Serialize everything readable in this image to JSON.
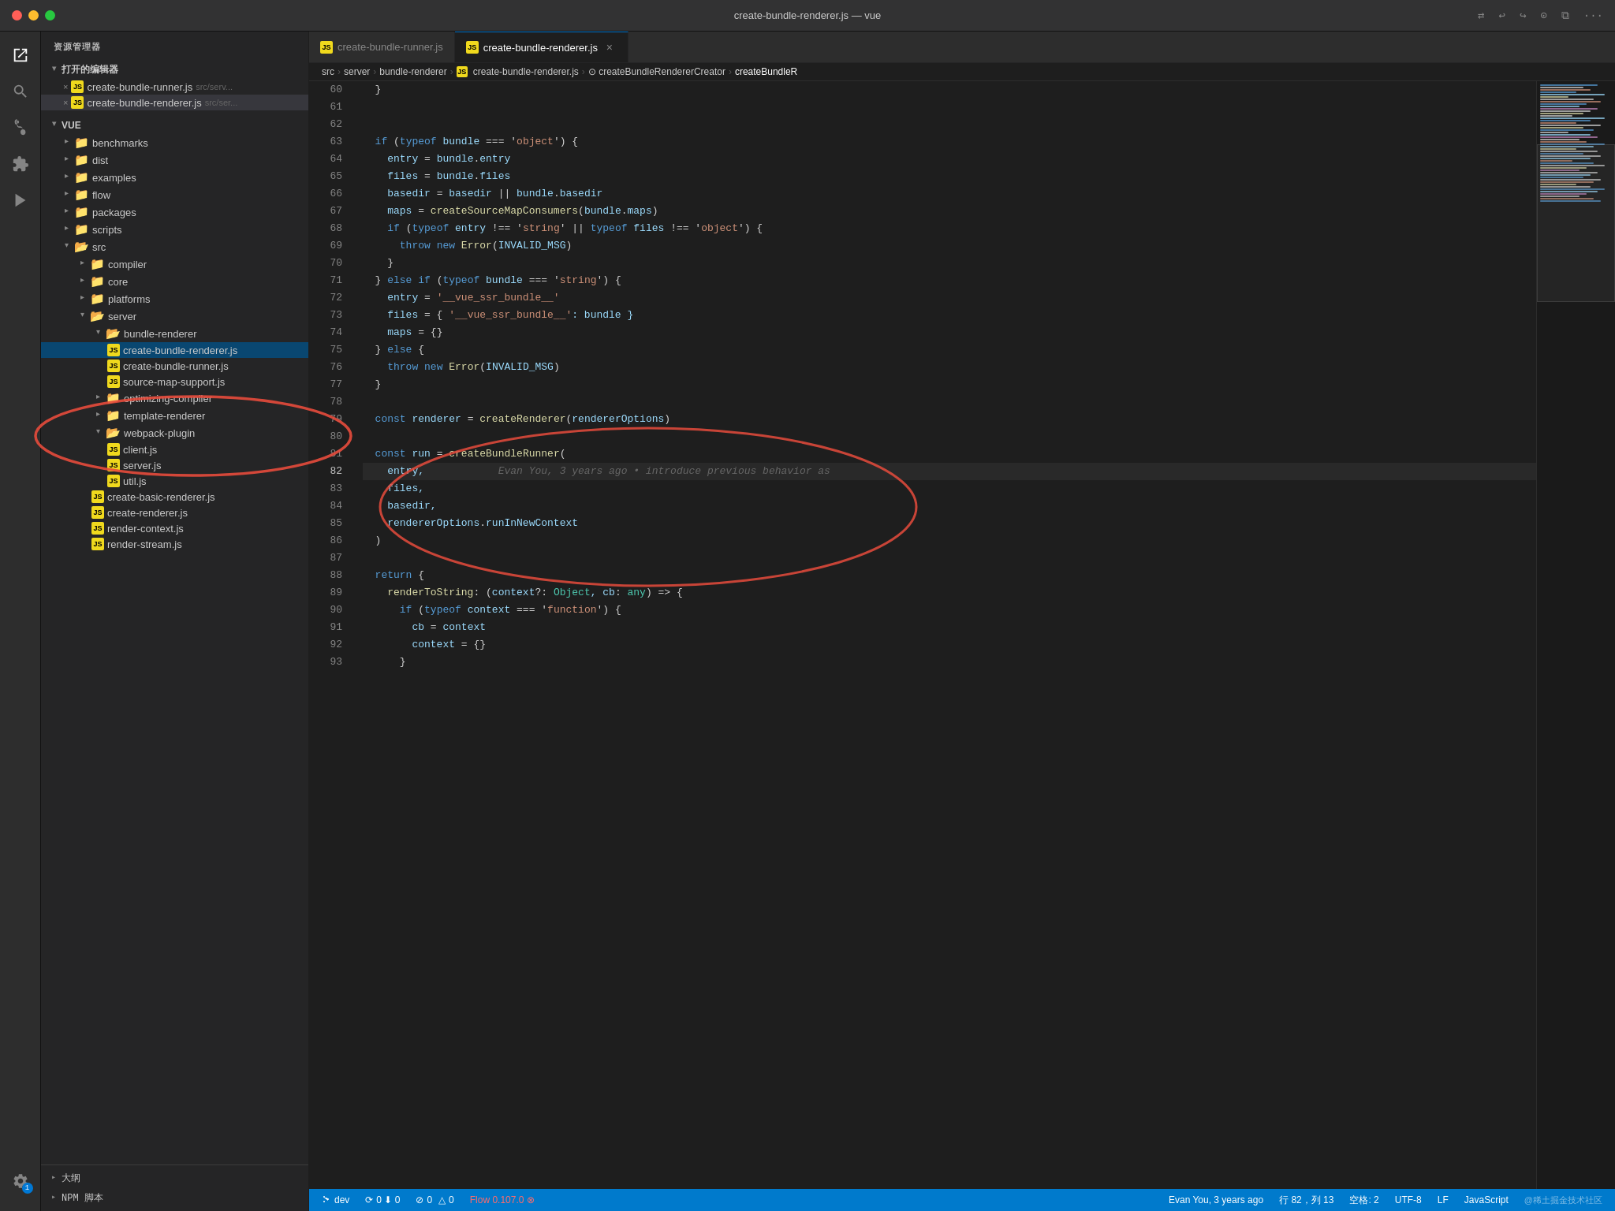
{
  "titlebar": {
    "title": "create-bundle-renderer.js — vue",
    "icons": [
      "sync",
      "back",
      "forward",
      "settings",
      "split",
      "more"
    ]
  },
  "tabs": [
    {
      "id": "tab1",
      "icon": "js",
      "label": "create-bundle-runner.js",
      "active": false,
      "dirty": false,
      "closeable": false
    },
    {
      "id": "tab2",
      "icon": "js",
      "label": "create-bundle-renderer.js",
      "active": true,
      "dirty": false,
      "closeable": true
    }
  ],
  "breadcrumb": {
    "items": [
      "src",
      "server",
      "bundle-renderer",
      "create-bundle-renderer.js",
      "createBundleRendererCreator",
      "createBundleR"
    ]
  },
  "sidebar": {
    "header": "资源管理器",
    "open_editors_label": "打开的编辑器",
    "open_files": [
      {
        "label": "create-bundle-runner.js",
        "path": "src/serv...",
        "dirty": false
      },
      {
        "label": "create-bundle-renderer.js",
        "path": "src/ser...",
        "dirty": true
      }
    ],
    "vue_label": "VUE",
    "tree": [
      {
        "id": "benchmarks",
        "label": "benchmarks",
        "type": "folder",
        "color": "blue",
        "indent": 1
      },
      {
        "id": "dist",
        "label": "dist",
        "type": "folder",
        "color": "yellow",
        "indent": 1
      },
      {
        "id": "examples",
        "label": "examples",
        "type": "folder",
        "color": "blue",
        "indent": 1
      },
      {
        "id": "flow",
        "label": "flow",
        "type": "folder",
        "color": "default",
        "indent": 1
      },
      {
        "id": "packages",
        "label": "packages",
        "type": "folder",
        "color": "blue",
        "indent": 1
      },
      {
        "id": "scripts",
        "label": "scripts",
        "type": "folder",
        "color": "default",
        "indent": 1
      },
      {
        "id": "src",
        "label": "src",
        "type": "folder",
        "color": "yellow",
        "open": true,
        "indent": 1
      },
      {
        "id": "compiler",
        "label": "compiler",
        "type": "folder",
        "color": "default",
        "indent": 2
      },
      {
        "id": "core",
        "label": "core",
        "type": "folder",
        "color": "blue",
        "indent": 2
      },
      {
        "id": "platforms",
        "label": "platforms",
        "type": "folder",
        "color": "default",
        "indent": 2
      },
      {
        "id": "server",
        "label": "server",
        "type": "folder",
        "color": "default",
        "open": true,
        "indent": 2
      },
      {
        "id": "bundle-renderer",
        "label": "bundle-renderer",
        "type": "folder",
        "color": "default",
        "open": true,
        "indent": 3
      },
      {
        "id": "create-bundle-renderer",
        "label": "create-bundle-renderer.js",
        "type": "file-js",
        "indent": 4,
        "active": true
      },
      {
        "id": "create-bundle-runner",
        "label": "create-bundle-runner.js",
        "type": "file-js",
        "indent": 4
      },
      {
        "id": "source-map-support",
        "label": "source-map-support.js",
        "type": "file-js",
        "indent": 4
      },
      {
        "id": "optimizing-compiler",
        "label": "optimizing-compiler",
        "type": "folder",
        "color": "default",
        "indent": 3
      },
      {
        "id": "template-renderer",
        "label": "template-renderer",
        "type": "folder",
        "color": "default",
        "indent": 3
      },
      {
        "id": "webpack-plugin",
        "label": "webpack-plugin",
        "type": "folder",
        "color": "default",
        "open": true,
        "indent": 3
      },
      {
        "id": "client-js",
        "label": "client.js",
        "type": "file-js",
        "indent": 4
      },
      {
        "id": "server-js",
        "label": "server.js",
        "type": "file-js",
        "indent": 4
      },
      {
        "id": "util-js",
        "label": "util.js",
        "type": "file-js",
        "indent": 4
      },
      {
        "id": "create-basic-renderer",
        "label": "create-basic-renderer.js",
        "type": "file-js",
        "indent": 3
      },
      {
        "id": "create-renderer",
        "label": "create-renderer.js",
        "type": "file-js",
        "indent": 3
      },
      {
        "id": "render-context",
        "label": "render-context.js",
        "type": "file-js",
        "indent": 3
      },
      {
        "id": "render-stream",
        "label": "render-stream.js",
        "type": "file-js",
        "indent": 3
      }
    ],
    "outline_label": "大纲",
    "npm_label": "NPM 脚本"
  },
  "code": {
    "lines": [
      {
        "num": 60,
        "tokens": [
          {
            "t": "  ",
            "c": ""
          },
          {
            "t": "}",
            "c": "punc"
          }
        ]
      },
      {
        "num": 61,
        "tokens": []
      },
      {
        "num": 62,
        "tokens": []
      },
      {
        "num": 63,
        "tokens": [
          {
            "t": "  ",
            "c": ""
          },
          {
            "t": "if",
            "c": "kw"
          },
          {
            "t": " (",
            "c": "punc"
          },
          {
            "t": "typeof",
            "c": "kw"
          },
          {
            "t": " bundle ",
            "c": "var"
          },
          {
            "t": "===",
            "c": "op"
          },
          {
            "t": " '",
            "c": "op"
          },
          {
            "t": "object",
            "c": "str"
          },
          {
            "t": "') {",
            "c": "punc"
          }
        ]
      },
      {
        "num": 64,
        "tokens": [
          {
            "t": "    entry",
            "c": "var"
          },
          {
            "t": " = ",
            "c": "op"
          },
          {
            "t": "bundle",
            "c": "var"
          },
          {
            "t": ".",
            "c": "punc"
          },
          {
            "t": "entry",
            "c": "prop"
          }
        ]
      },
      {
        "num": 65,
        "tokens": [
          {
            "t": "    files",
            "c": "var"
          },
          {
            "t": " = ",
            "c": "op"
          },
          {
            "t": "bundle",
            "c": "var"
          },
          {
            "t": ".",
            "c": "punc"
          },
          {
            "t": "files",
            "c": "prop"
          }
        ]
      },
      {
        "num": 66,
        "tokens": [
          {
            "t": "    basedir",
            "c": "var"
          },
          {
            "t": " = ",
            "c": "op"
          },
          {
            "t": "basedir",
            "c": "var"
          },
          {
            "t": " || ",
            "c": "op"
          },
          {
            "t": "bundle",
            "c": "var"
          },
          {
            "t": ".",
            "c": "punc"
          },
          {
            "t": "basedir",
            "c": "prop"
          }
        ]
      },
      {
        "num": 67,
        "tokens": [
          {
            "t": "    maps",
            "c": "var"
          },
          {
            "t": " = ",
            "c": "op"
          },
          {
            "t": "createSourceMapConsumers",
            "c": "fn"
          },
          {
            "t": "(",
            "c": "punc"
          },
          {
            "t": "bundle",
            "c": "var"
          },
          {
            "t": ".",
            "c": "punc"
          },
          {
            "t": "maps",
            "c": "prop"
          },
          {
            "t": ")",
            "c": "punc"
          }
        ]
      },
      {
        "num": 68,
        "tokens": [
          {
            "t": "    ",
            "c": ""
          },
          {
            "t": "if",
            "c": "kw"
          },
          {
            "t": " (",
            "c": "punc"
          },
          {
            "t": "typeof",
            "c": "kw"
          },
          {
            "t": " entry ",
            "c": "var"
          },
          {
            "t": "!==",
            "c": "op"
          },
          {
            "t": " '",
            "c": "op"
          },
          {
            "t": "string",
            "c": "str"
          },
          {
            "t": "' || ",
            "c": "op"
          },
          {
            "t": "typeof",
            "c": "kw"
          },
          {
            "t": " files ",
            "c": "var"
          },
          {
            "t": "!==",
            "c": "op"
          },
          {
            "t": " '",
            "c": "op"
          },
          {
            "t": "object",
            "c": "str"
          },
          {
            "t": "') {",
            "c": "punc"
          }
        ]
      },
      {
        "num": 69,
        "tokens": [
          {
            "t": "      ",
            "c": ""
          },
          {
            "t": "throw",
            "c": "kw"
          },
          {
            "t": " ",
            "c": ""
          },
          {
            "t": "new",
            "c": "kw"
          },
          {
            "t": " ",
            "c": ""
          },
          {
            "t": "Error",
            "c": "fn"
          },
          {
            "t": "(",
            "c": "punc"
          },
          {
            "t": "INVALID_MSG",
            "c": "var"
          },
          {
            "t": ")",
            "c": "punc"
          }
        ]
      },
      {
        "num": 70,
        "tokens": [
          {
            "t": "    }",
            "c": "punc"
          }
        ]
      },
      {
        "num": 71,
        "tokens": [
          {
            "t": "  } ",
            "c": "punc"
          },
          {
            "t": "else if",
            "c": "kw"
          },
          {
            "t": " (",
            "c": "punc"
          },
          {
            "t": "typeof",
            "c": "kw"
          },
          {
            "t": " bundle ",
            "c": "var"
          },
          {
            "t": "===",
            "c": "op"
          },
          {
            "t": " '",
            "c": "op"
          },
          {
            "t": "string",
            "c": "str"
          },
          {
            "t": "') {",
            "c": "punc"
          }
        ]
      },
      {
        "num": 72,
        "tokens": [
          {
            "t": "    entry",
            "c": "var"
          },
          {
            "t": " = ",
            "c": "op"
          },
          {
            "t": "'__vue_ssr_bundle__'",
            "c": "str"
          }
        ]
      },
      {
        "num": 73,
        "tokens": [
          {
            "t": "    files",
            "c": "var"
          },
          {
            "t": " = { ",
            "c": "op"
          },
          {
            "t": "'__vue_ssr_bundle__'",
            "c": "str"
          },
          {
            "t": ": bundle }",
            "c": "var"
          }
        ]
      },
      {
        "num": 74,
        "tokens": [
          {
            "t": "    maps",
            "c": "var"
          },
          {
            "t": " = {}",
            "c": "op"
          }
        ]
      },
      {
        "num": 75,
        "tokens": [
          {
            "t": "  } ",
            "c": "punc"
          },
          {
            "t": "else",
            "c": "kw"
          },
          {
            "t": " {",
            "c": "punc"
          }
        ]
      },
      {
        "num": 76,
        "tokens": [
          {
            "t": "    ",
            "c": ""
          },
          {
            "t": "throw",
            "c": "kw"
          },
          {
            "t": " ",
            "c": ""
          },
          {
            "t": "new",
            "c": "kw"
          },
          {
            "t": " ",
            "c": ""
          },
          {
            "t": "Error",
            "c": "fn"
          },
          {
            "t": "(",
            "c": "punc"
          },
          {
            "t": "INVALID_MSG",
            "c": "var"
          },
          {
            "t": ")",
            "c": "punc"
          }
        ]
      },
      {
        "num": 77,
        "tokens": [
          {
            "t": "  }",
            "c": "punc"
          }
        ]
      },
      {
        "num": 78,
        "tokens": []
      },
      {
        "num": 79,
        "tokens": [
          {
            "t": "  ",
            "c": ""
          },
          {
            "t": "const",
            "c": "kw"
          },
          {
            "t": " renderer ",
            "c": "var"
          },
          {
            "t": "=",
            "c": "op"
          },
          {
            "t": " ",
            "c": ""
          },
          {
            "t": "createRenderer",
            "c": "fn"
          },
          {
            "t": "(",
            "c": "punc"
          },
          {
            "t": "rendererOptions",
            "c": "var"
          },
          {
            "t": ")",
            "c": "punc"
          }
        ]
      },
      {
        "num": 80,
        "tokens": []
      },
      {
        "num": 81,
        "tokens": [
          {
            "t": "  ",
            "c": ""
          },
          {
            "t": "const",
            "c": "kw"
          },
          {
            "t": " run ",
            "c": "var"
          },
          {
            "t": "=",
            "c": "op"
          },
          {
            "t": " ",
            "c": ""
          },
          {
            "t": "createBundleRunner",
            "c": "fn"
          },
          {
            "t": "(",
            "c": "punc"
          }
        ]
      },
      {
        "num": 82,
        "tokens": [
          {
            "t": "    entry,",
            "c": "var"
          },
          {
            "t": "            ",
            "c": ""
          },
          {
            "t": "Evan You, 3 years ago • introduce previous behavior as",
            "c": "git-blame"
          }
        ],
        "highlighted": true
      },
      {
        "num": 83,
        "tokens": [
          {
            "t": "    files,",
            "c": "var"
          }
        ]
      },
      {
        "num": 84,
        "tokens": [
          {
            "t": "    basedir,",
            "c": "var"
          }
        ]
      },
      {
        "num": 85,
        "tokens": [
          {
            "t": "    rendererOptions",
            "c": "var"
          },
          {
            "t": ".",
            "c": "punc"
          },
          {
            "t": "runInNewContext",
            "c": "prop"
          }
        ]
      },
      {
        "num": 86,
        "tokens": [
          {
            "t": "  )",
            "c": "punc"
          }
        ]
      },
      {
        "num": 87,
        "tokens": []
      },
      {
        "num": 88,
        "tokens": [
          {
            "t": "  ",
            "c": ""
          },
          {
            "t": "return",
            "c": "kw"
          },
          {
            "t": " {",
            "c": "punc"
          }
        ]
      },
      {
        "num": 89,
        "tokens": [
          {
            "t": "    renderToString",
            "c": "fn"
          },
          {
            "t": ": (",
            "c": "punc"
          },
          {
            "t": "context",
            "c": "var"
          },
          {
            "t": "?",
            "c": "op"
          },
          {
            "t": ": ",
            "c": "punc"
          },
          {
            "t": "Object",
            "c": "type"
          },
          {
            "t": ", cb",
            "c": "var"
          },
          {
            "t": ": ",
            "c": "punc"
          },
          {
            "t": "any",
            "c": "type"
          },
          {
            "t": ") => {",
            "c": "punc"
          }
        ]
      },
      {
        "num": 90,
        "tokens": [
          {
            "t": "      ",
            "c": ""
          },
          {
            "t": "if",
            "c": "kw"
          },
          {
            "t": " (",
            "c": "punc"
          },
          {
            "t": "typeof",
            "c": "kw"
          },
          {
            "t": " context ",
            "c": "var"
          },
          {
            "t": "===",
            "c": "op"
          },
          {
            "t": " '",
            "c": "op"
          },
          {
            "t": "function",
            "c": "str"
          },
          {
            "t": "') {",
            "c": "punc"
          }
        ]
      },
      {
        "num": 91,
        "tokens": [
          {
            "t": "        cb",
            "c": "var"
          },
          {
            "t": " = ",
            "c": "op"
          },
          {
            "t": "context",
            "c": "var"
          }
        ]
      },
      {
        "num": 92,
        "tokens": [
          {
            "t": "        context",
            "c": "var"
          },
          {
            "t": " = {}",
            "c": "op"
          }
        ]
      },
      {
        "num": 93,
        "tokens": [
          {
            "t": "      }",
            "c": "punc"
          }
        ]
      }
    ]
  },
  "status": {
    "branch": "dev",
    "sync_icon": "⟳",
    "errors": "0",
    "warnings": "0",
    "flow": "Flow 0.107.0",
    "cursor": "行 82，列 13",
    "spaces": "空格: 2",
    "encoding": "UTF-8",
    "line_ending": "LF",
    "language": "JavaScript",
    "watermark": "@稀土掘金技术社区",
    "git_user": "Evan You, 3 years ago"
  }
}
